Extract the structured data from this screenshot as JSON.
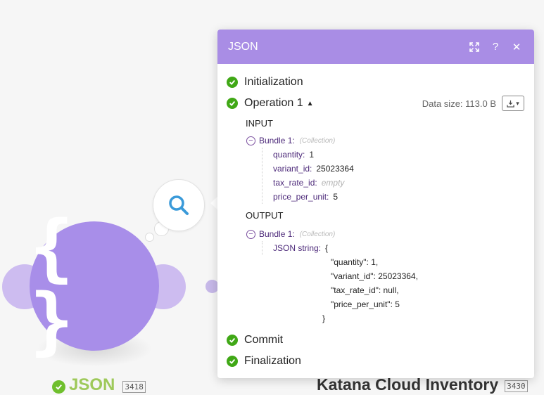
{
  "panel": {
    "title": "JSON",
    "sections": {
      "initialization": "Initialization",
      "operation": "Operation 1",
      "commit": "Commit",
      "finalization": "Finalization"
    },
    "data_size": "Data size: 113.0 B",
    "input_label": "INPUT",
    "output_label": "OUTPUT",
    "input_bundle": {
      "name": "Bundle 1:",
      "type": "(Collection)",
      "fields": [
        {
          "key": "quantity:",
          "value": "1"
        },
        {
          "key": "variant_id:",
          "value": "25023364"
        },
        {
          "key": "tax_rate_id:",
          "value": "empty"
        },
        {
          "key": "price_per_unit:",
          "value": "5"
        }
      ]
    },
    "output_bundle": {
      "name": "Bundle 1:",
      "type": "(Collection)",
      "json_key": "JSON string:",
      "json_lines": [
        "{",
        "\"quantity\": 1,",
        "\"variant_id\": 25023364,",
        "\"tax_rate_id\": null,",
        "\"price_per_unit\": 5",
        "}"
      ]
    }
  },
  "module": {
    "name": "JSON",
    "id": "3418",
    "icon": "curly-braces"
  },
  "next_module": {
    "name": "Katana Cloud Inventory",
    "id": "3430"
  },
  "colors": {
    "accent": "#a98de5",
    "check": "#40a816",
    "module": "#a88ee9"
  }
}
